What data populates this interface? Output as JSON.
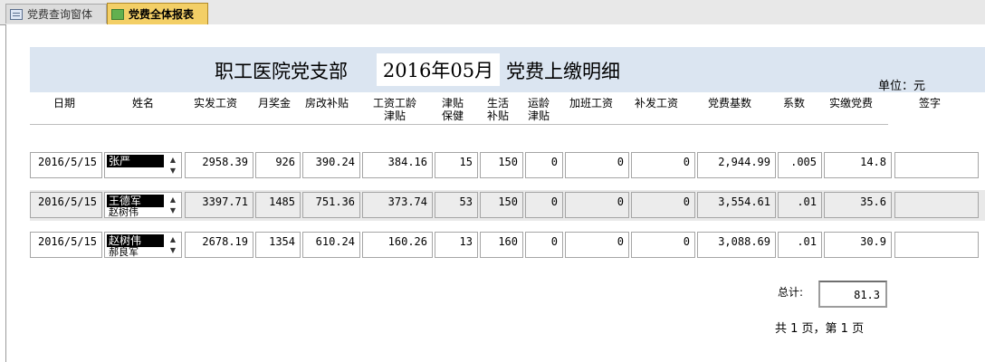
{
  "tabs": [
    {
      "label": "党费查询窗体",
      "icon": "form-icon"
    },
    {
      "label": "党费全体报表",
      "icon": "report-icon"
    }
  ],
  "report": {
    "title_left": "职工医院党支部",
    "title_month": "2016年05月",
    "title_right": "党费上缴明细",
    "unit": "单位：元"
  },
  "columns": [
    {
      "label": "日期"
    },
    {
      "label": "姓名"
    },
    {
      "label": "实发工资"
    },
    {
      "label": "月奖金"
    },
    {
      "label": "房改补贴"
    },
    {
      "label": "工资工龄\n津贴"
    },
    {
      "label": "津贴\n保健"
    },
    {
      "label": "生活\n补贴"
    },
    {
      "label": "运龄\n津贴"
    },
    {
      "label": "加班工资"
    },
    {
      "label": "补发工资"
    },
    {
      "label": "党费基数"
    },
    {
      "label": "系数"
    },
    {
      "label": "实缴党费"
    },
    {
      "label": "签字"
    }
  ],
  "rows": [
    {
      "date": "2016/5/15",
      "name": "张严",
      "name_next": "",
      "salary": "2958.39",
      "bonus": "926",
      "housing": "390.24",
      "seniority": "384.16",
      "health": "15",
      "living": "150",
      "transport": "0",
      "overtime": "0",
      "back_pay": "0",
      "base": "2,944.99",
      "rate": ".005",
      "dues": "14.8",
      "signature": ""
    },
    {
      "date": "2016/5/15",
      "name": "王德军",
      "name_next": "赵树伟",
      "salary": "3397.71",
      "bonus": "1485",
      "housing": "751.36",
      "seniority": "373.74",
      "health": "53",
      "living": "150",
      "transport": "0",
      "overtime": "0",
      "back_pay": "0",
      "base": "3,554.61",
      "rate": ".01",
      "dues": "35.6",
      "signature": ""
    },
    {
      "date": "2016/5/15",
      "name": "赵树伟",
      "name_next": "郝良军",
      "salary": "2678.19",
      "bonus": "1354",
      "housing": "610.24",
      "seniority": "160.26",
      "health": "13",
      "living": "160",
      "transport": "0",
      "overtime": "0",
      "back_pay": "0",
      "base": "3,088.69",
      "rate": ".01",
      "dues": "30.9",
      "signature": ""
    }
  ],
  "footer": {
    "total_label": "总计:",
    "total_value": "81.3",
    "page_info": "共 1 页，第 1 页"
  }
}
